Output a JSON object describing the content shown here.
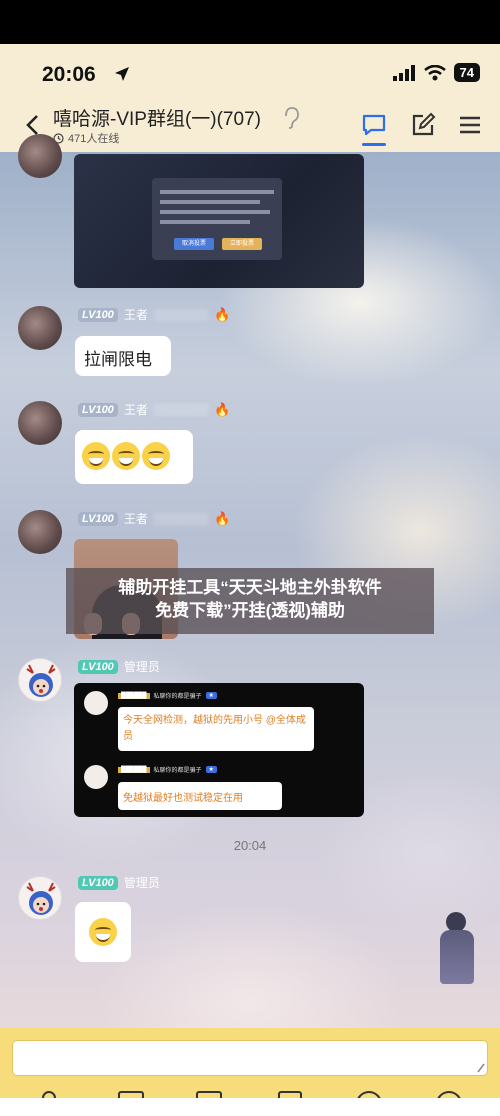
{
  "status_bar": {
    "time": "20:06",
    "battery": "74"
  },
  "header": {
    "group_name": "嘻哈源-VIP群组(一)(707)",
    "online_count": "471人在线"
  },
  "messages": [
    {
      "level": "LV100",
      "title": "王者",
      "text": "拉闸限电"
    },
    {
      "level": "LV100",
      "title": "王者"
    },
    {
      "level": "LV100",
      "title": "王者"
    },
    {
      "level": "LV100",
      "title": "管理员"
    },
    {
      "level": "LV100",
      "title": "管理员"
    }
  ],
  "screenshot_dialog": {
    "cancel_label": "取消投票",
    "confirm_label": "立即投票"
  },
  "inner_chat": {
    "line1": "私聊你的都是骗子",
    "msg1": "今天全网检测，越狱的先用小号 @全体成员",
    "line2": "私聊你的都是骗子",
    "msg2": "免越狱最好也测试稳定在用"
  },
  "banner": {
    "line1": "辅助开挂工具“天天斗地主外卦软件",
    "line2": "免费下载”开挂(透视)辅助"
  },
  "timestamp": "20:04",
  "colors": {
    "header_bg": "#f7edd4",
    "input_bar_bg": "#f7dc7c",
    "accent_blue": "#2c6ef0",
    "admin_badge": "#50c8b4"
  }
}
